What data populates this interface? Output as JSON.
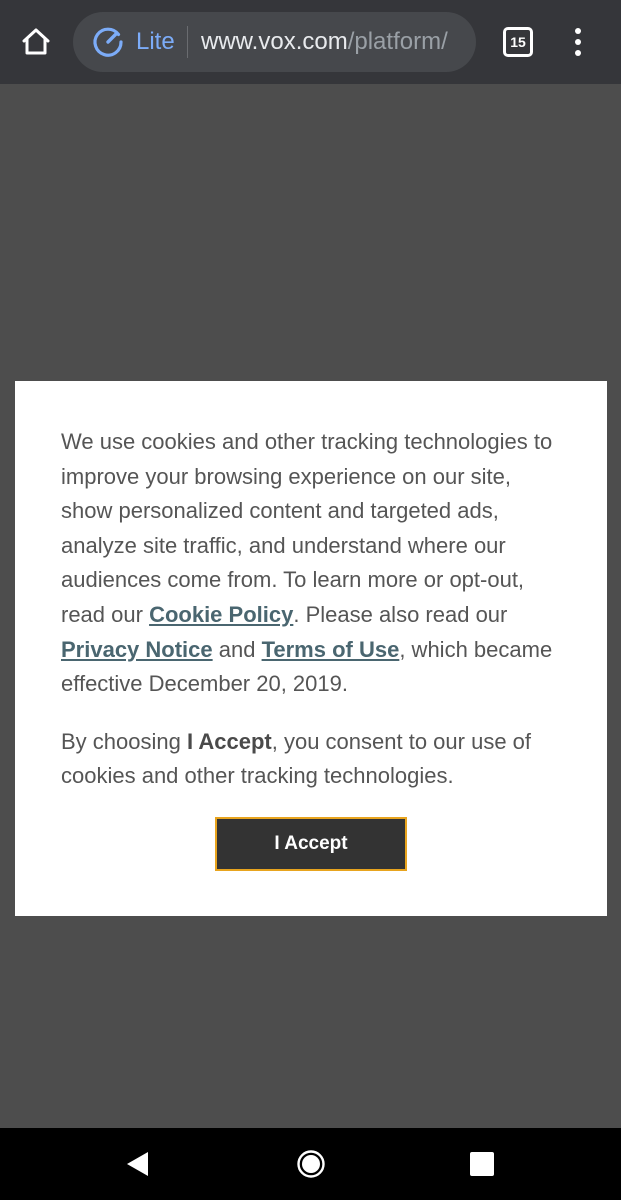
{
  "browser": {
    "mode_label": "Lite",
    "url_domain": "www.vox.com",
    "url_path": "/platform/",
    "tab_count": "15",
    "icons": {
      "home": "home-icon",
      "lite": "lite-mode-icon",
      "tabs": "tabs-icon",
      "menu": "more-vert-icon"
    },
    "accent_color": "#7cacf8"
  },
  "dialog": {
    "p1_text_before": "We use cookies and other tracking technologies to improve your browsing experience on our site, show personalized content and targeted ads, analyze site traffic, and understand where our audiences come from. To learn more or opt-out, read our ",
    "cookie_policy_link": "Cookie Policy",
    "p1_text_middle": ". Please also read our ",
    "privacy_notice_link": "Privacy Notice",
    "p1_and": " and ",
    "terms_link": "Terms of Use",
    "p1_text_after": ", which became effective December 20, 2019.",
    "p2_before": "By choosing ",
    "p2_bold": "I Accept",
    "p2_after": ", you consent to our use of cookies and other tracking technologies.",
    "accept_button": "I Accept",
    "link_color": "#4a6670",
    "button_border_color": "#e8a41e"
  },
  "navbar": {
    "icons": {
      "back": "back-triangle-icon",
      "home": "home-circle-icon",
      "recent": "recent-apps-square-icon"
    }
  }
}
